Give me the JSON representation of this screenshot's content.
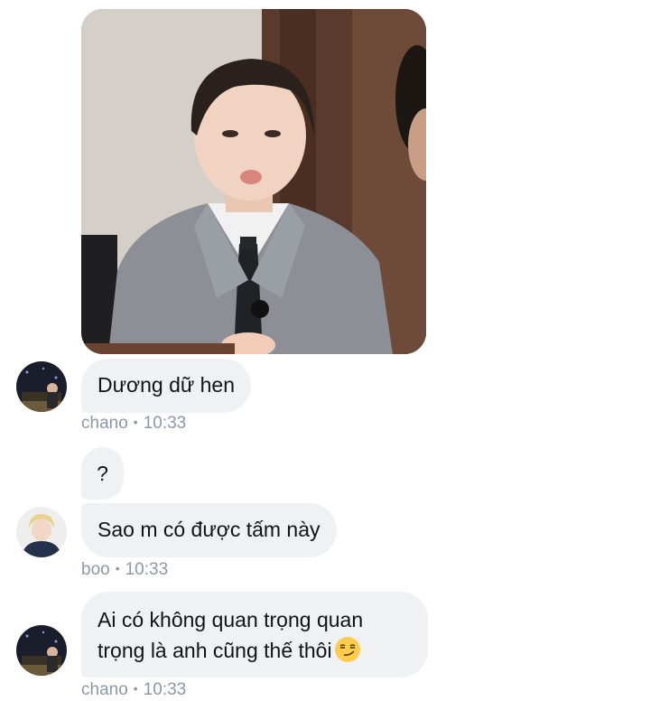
{
  "shared_image": {
    "icon": "person-photo"
  },
  "messages": [
    {
      "sender": "chano",
      "text": "Dương dữ hen",
      "time": "10:33",
      "separator": "•"
    },
    {
      "sender": "boo",
      "text_first": "?",
      "text_second": "Sao m có được tấm này",
      "time": "10:33",
      "separator": "•"
    },
    {
      "sender": "chano",
      "line1": "Ai có không quan trọng quan",
      "line2": "trọng là anh cũng thế thôi",
      "emoji": "smirking-face",
      "time": "10:33",
      "separator": "•"
    }
  ],
  "colors": {
    "bubble_bg": "#eff1f3",
    "text": "#0f1419",
    "meta": "#8b98a5"
  }
}
